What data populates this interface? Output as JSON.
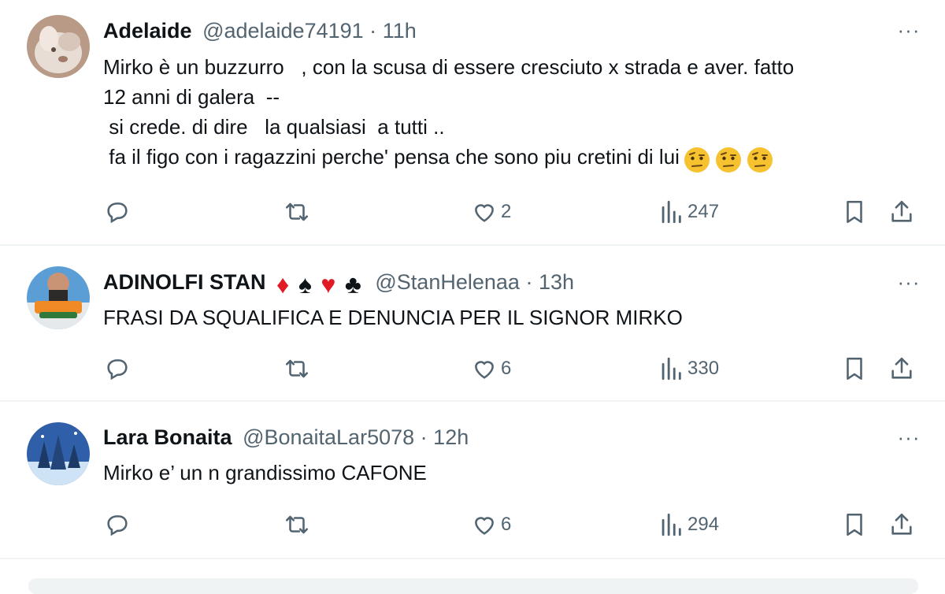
{
  "tweets": [
    {
      "name": "Adelaide",
      "handle": "@adelaide74191",
      "dot": "·",
      "time": "11h",
      "more": "···",
      "body": "Mirko è un buzzurro   , con la scusa di essere cresciuto x strada e aver. fatto\n12 anni di galera  --\n si crede. di dire   la qualsiasi  a tutti ..\n fa il figo con i ragazzini perche' pensa che sono piu cretini di lui",
      "emojis": [
        "face-with-raised-eyebrow",
        "face-with-raised-eyebrow",
        "face-with-raised-eyebrow"
      ],
      "likes": "2",
      "views": "247"
    },
    {
      "name": "ADINOLFI STAN",
      "suits": [
        "♦",
        "♠",
        "♥",
        "♣"
      ],
      "handle": "@StanHelenaa",
      "dot": "·",
      "time": "13h",
      "more": "···",
      "body": "FRASI DA SQUALIFICA E DENUNCIA PER IL SIGNOR MIRKO",
      "likes": "6",
      "views": "330"
    },
    {
      "name": "Lara Bonaita",
      "handle": "@BonaitaLar5078",
      "dot": "·",
      "time": "12h",
      "more": "···",
      "body": "Mirko e’ un n grandissimo CAFONE",
      "likes": "6",
      "views": "294"
    }
  ],
  "icons": {
    "reply": "reply-icon",
    "retweet": "retweet-icon",
    "like": "heart-icon",
    "views": "views-chart-icon",
    "bookmark": "bookmark-icon",
    "share": "share-icon"
  },
  "colors": {
    "text": "#0f1419",
    "secondary": "#536471",
    "divider": "#eff3f4",
    "suit_red": "#e01b24"
  }
}
